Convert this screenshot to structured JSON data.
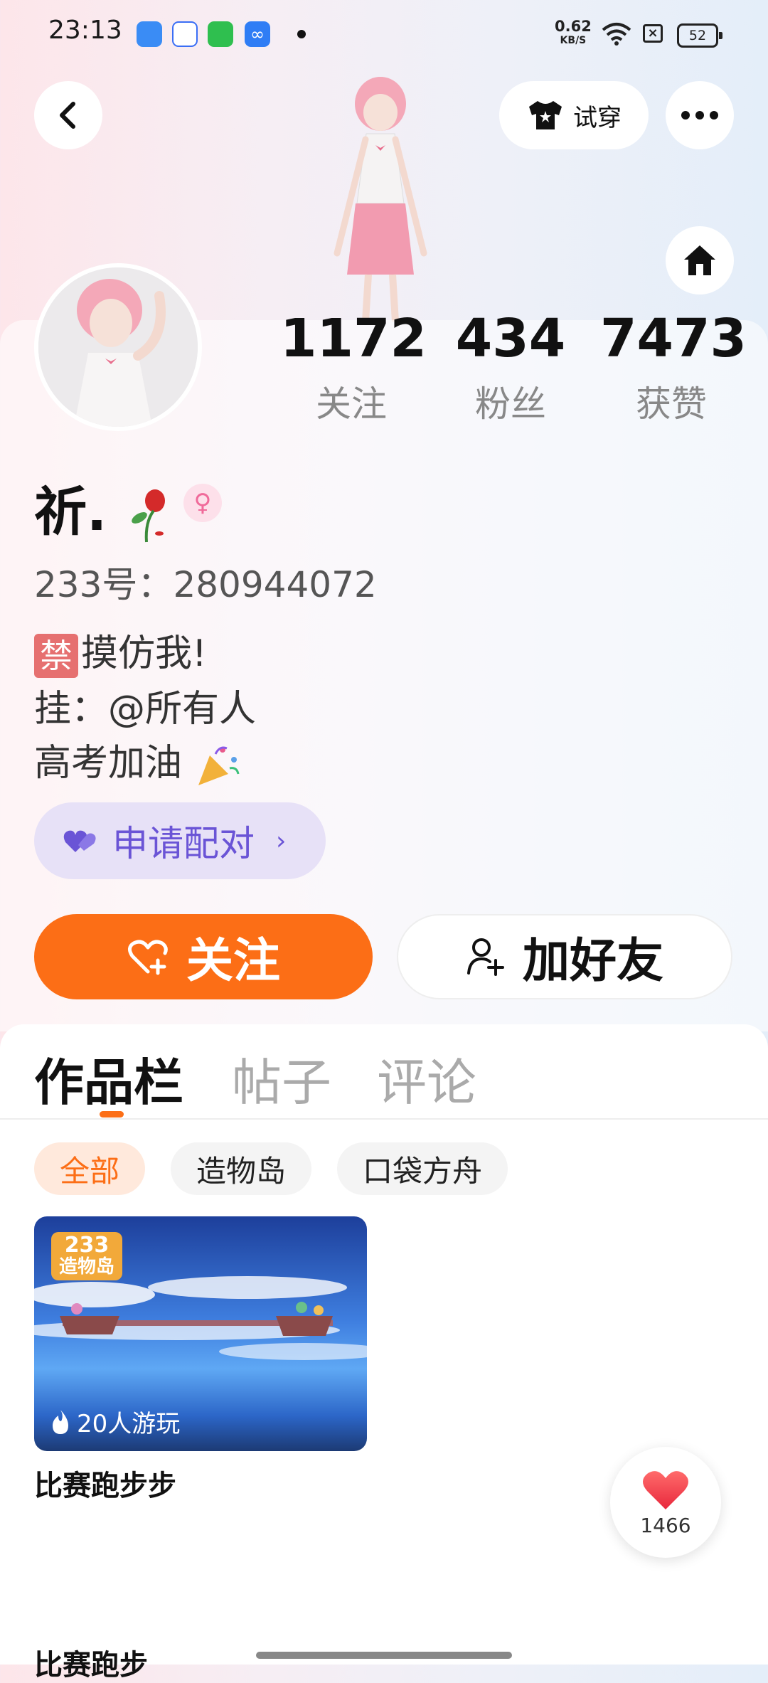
{
  "status_bar": {
    "time": "23:13",
    "net_speed_value": "0.62",
    "net_speed_unit": "KB/S",
    "battery": "52",
    "app_icons": [
      "blue-app-icon",
      "baidu-icon",
      "green-app-icon",
      "infinity-app-icon"
    ]
  },
  "header": {
    "try_on_label": "试穿",
    "back_icon": "back-arrow-icon",
    "more_icon": "more-icon",
    "home_icon": "home-icon"
  },
  "stats": [
    {
      "value": "1172",
      "label": "关注"
    },
    {
      "value": "434",
      "label": "粉丝"
    },
    {
      "value": "7473",
      "label": "获赞"
    }
  ],
  "profile": {
    "name": "祈.",
    "gender": "female",
    "uid_label": "233号：",
    "uid": "280944072",
    "bio_tag": "禁",
    "bio_line1": "摸仿我!",
    "bio_line2": "挂：@所有人",
    "bio_line3": "高考加油"
  },
  "pair_button": {
    "label": "申请配对"
  },
  "actions": {
    "follow": "关注",
    "add_friend": "加好友"
  },
  "tabs": [
    {
      "label": "作品栏",
      "active": true
    },
    {
      "label": "帖子",
      "active": false
    },
    {
      "label": "评论",
      "active": false
    }
  ],
  "filters": [
    {
      "label": "全部",
      "active": true
    },
    {
      "label": "造物岛",
      "active": false
    },
    {
      "label": "口袋方舟",
      "active": false
    }
  ],
  "works": [
    {
      "title": "比赛跑步步",
      "players": "20人游玩",
      "logo_top": "233",
      "logo_bottom": "造物岛"
    }
  ],
  "next_work_title": "比赛跑步",
  "like_float": {
    "count": "1466"
  },
  "colors": {
    "accent": "#fc6e16",
    "pair_purple": "#6a54d6",
    "pair_bg": "#e7e1f7"
  }
}
